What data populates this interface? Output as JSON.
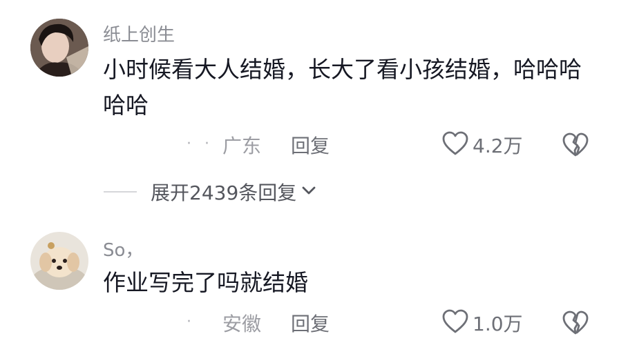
{
  "comments": [
    {
      "username": "纸上创生",
      "content": "小时候看大人结婚，长大了看小孩结婚，哈哈哈哈哈",
      "time": "· ·",
      "location": "广东",
      "reply_label": "回复",
      "like_count": "4.2万",
      "expand_label": "展开2439条回复"
    },
    {
      "username": "So，",
      "content": "作业写完了吗就结婚",
      "time": "·",
      "location": "安徽",
      "reply_label": "回复",
      "like_count": "1.0万"
    }
  ],
  "icons": {
    "like": "heart-outline-icon",
    "dislike": "broken-heart-icon",
    "expand": "chevron-down-icon"
  },
  "colors": {
    "text_primary": "#161823",
    "text_secondary": "#8a8c93",
    "icon": "#6d6f76"
  }
}
